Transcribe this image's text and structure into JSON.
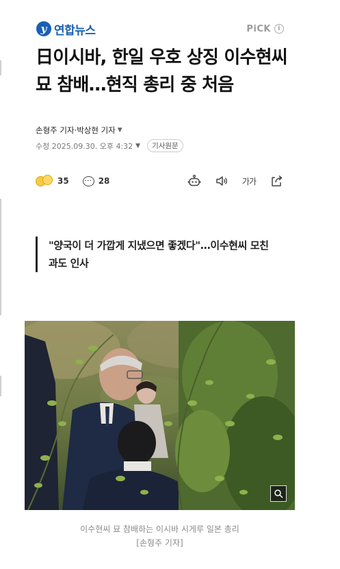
{
  "header": {
    "brand_name": "연합뉴스",
    "brand_logo_letter": "y",
    "pick_label": "PiCK",
    "info_symbol": "i"
  },
  "article": {
    "headline": "日이시바, 한일 우호 상징 이수현씨 묘 참배…현직 총리 중 처음",
    "byline": "손형주 기자·박상현 기자",
    "dateline": "수정 2025.09.30. 오후 4:32",
    "original_button": "기사원문",
    "quote": "\"양국이 더 가깝게 지냈으면 좋겠다\"…이수현씨 모친과도 인사",
    "photo_caption_line1": "이수현씨 묘 참배하는 이시바 시게루 일본 총리",
    "photo_caption_line2": "[손형주 기자]"
  },
  "actions": {
    "reaction_count": "35",
    "comment_count": "28",
    "comment_icon_glyph": "···",
    "font_size_label": "가가",
    "icons": [
      "reaction-emoji-icon",
      "comment-icon",
      "ai-summary-icon",
      "speaker-icon",
      "font-size-icon",
      "share-icon"
    ]
  },
  "colors": {
    "brand_blue": "#1a5fb4",
    "muted_text": "#8a8a8a",
    "body_text": "#111111"
  }
}
